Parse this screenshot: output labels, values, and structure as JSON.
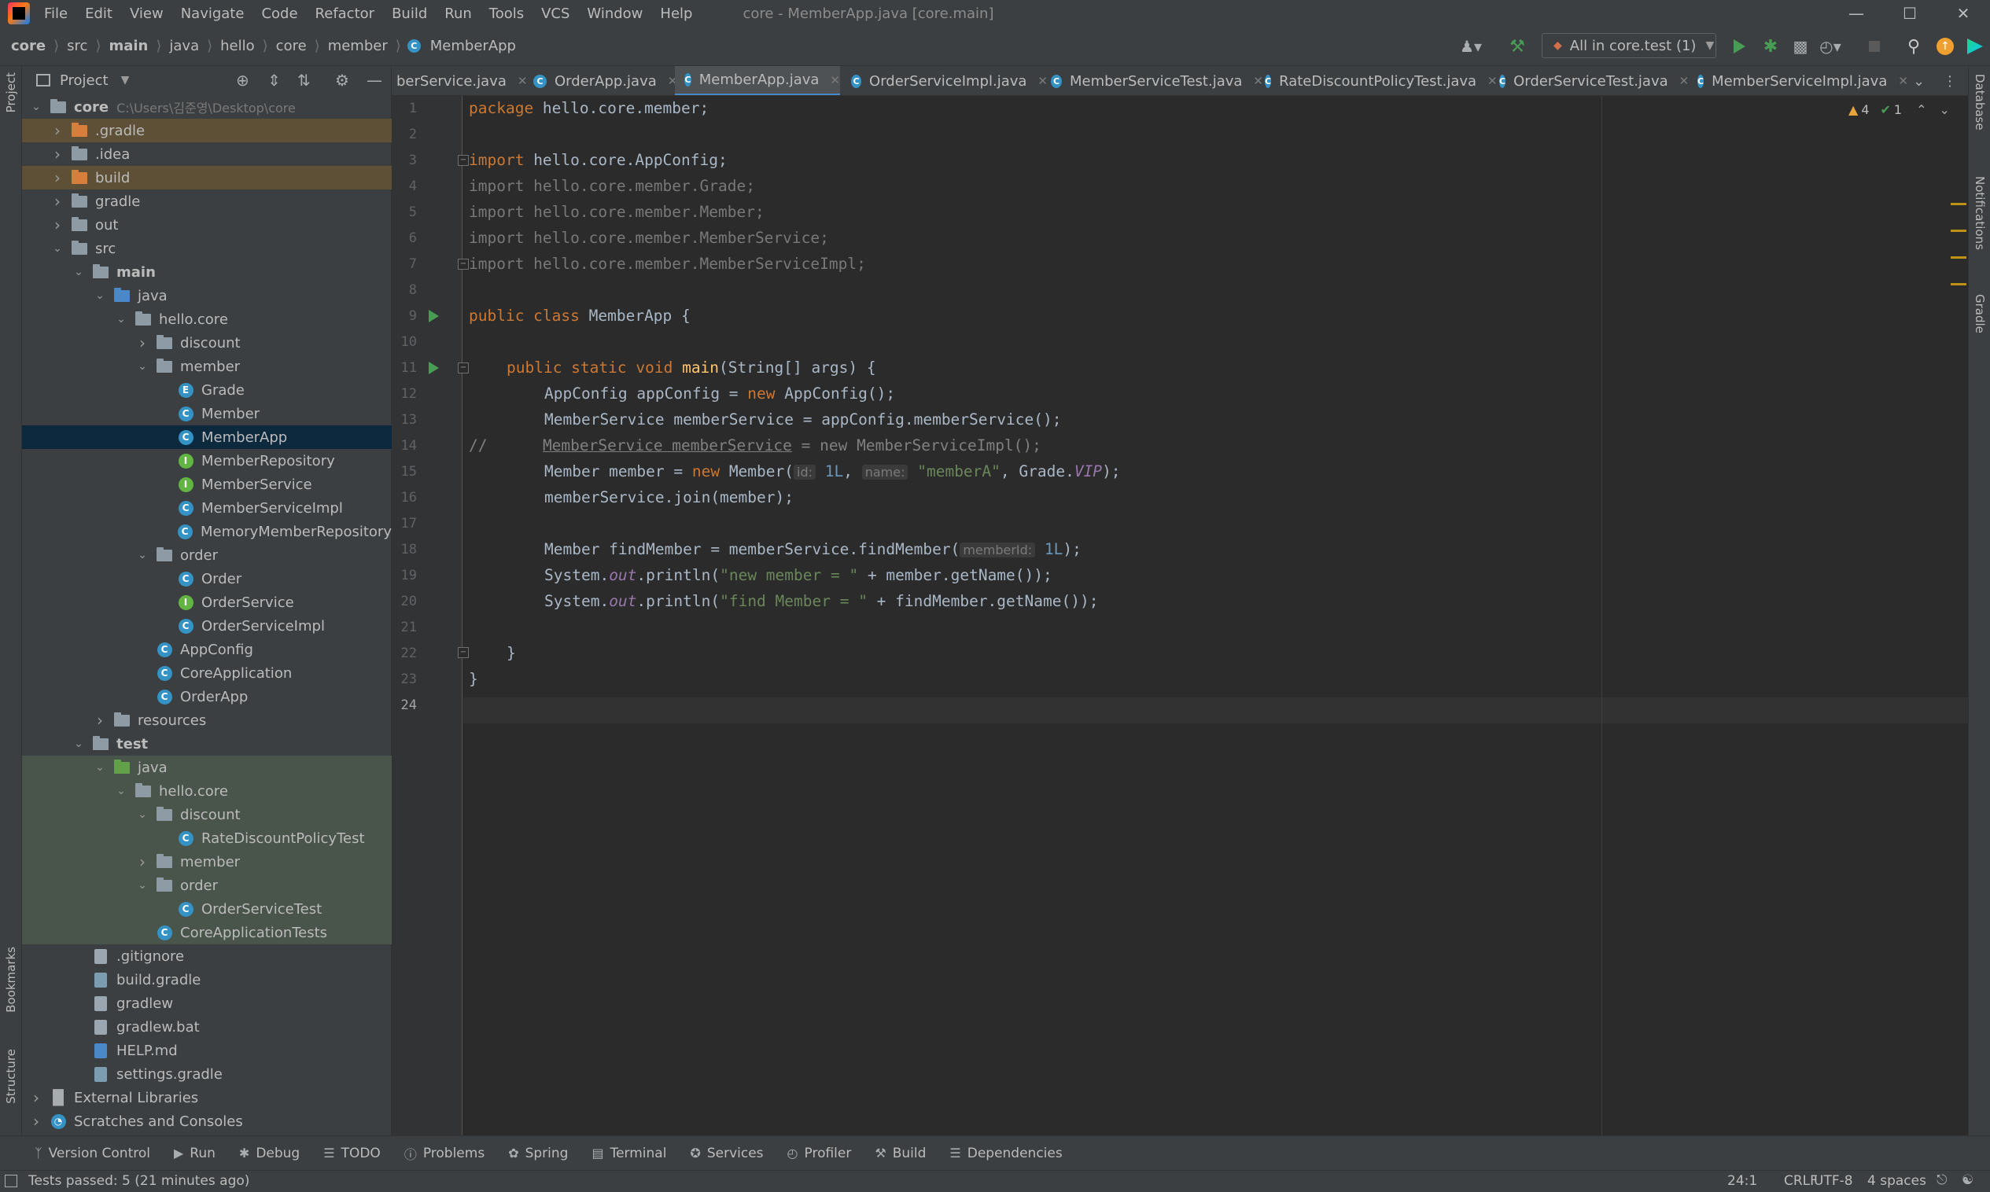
{
  "menu": [
    "File",
    "Edit",
    "View",
    "Navigate",
    "Code",
    "Refactor",
    "Build",
    "Run",
    "Tools",
    "VCS",
    "Window",
    "Help"
  ],
  "window_title": "core - MemberApp.java [core.main]",
  "breadcrumb": [
    "core",
    "src",
    "main",
    "java",
    "hello",
    "core",
    "member",
    "MemberApp"
  ],
  "run_config": "All in core.test (1)",
  "project_panel": {
    "title": "Project",
    "root_path": "C:\\Users\\김준영\\Desktop\\core",
    "tree": [
      {
        "label": "core",
        "depth": 0,
        "icon": "module",
        "expanded": true,
        "bold": true
      },
      {
        "label": ".gradle",
        "depth": 1,
        "icon": "folder-orange",
        "expanded": false
      },
      {
        "label": ".idea",
        "depth": 1,
        "icon": "folder",
        "expanded": false
      },
      {
        "label": "build",
        "depth": 1,
        "icon": "folder-orange",
        "expanded": false
      },
      {
        "label": "gradle",
        "depth": 1,
        "icon": "folder",
        "expanded": false
      },
      {
        "label": "out",
        "depth": 1,
        "icon": "folder",
        "expanded": false
      },
      {
        "label": "src",
        "depth": 1,
        "icon": "folder",
        "expanded": true
      },
      {
        "label": "main",
        "depth": 2,
        "icon": "folder",
        "expanded": true,
        "bold": true
      },
      {
        "label": "java",
        "depth": 3,
        "icon": "folder-blue",
        "expanded": true
      },
      {
        "label": "hello.core",
        "depth": 4,
        "icon": "package",
        "expanded": true
      },
      {
        "label": "discount",
        "depth": 5,
        "icon": "package",
        "expanded": false
      },
      {
        "label": "member",
        "depth": 5,
        "icon": "package",
        "expanded": true
      },
      {
        "label": "Grade",
        "depth": 6,
        "icon": "enum"
      },
      {
        "label": "Member",
        "depth": 6,
        "icon": "class"
      },
      {
        "label": "MemberApp",
        "depth": 6,
        "icon": "class",
        "selected": true
      },
      {
        "label": "MemberRepository",
        "depth": 6,
        "icon": "interface"
      },
      {
        "label": "MemberService",
        "depth": 6,
        "icon": "interface"
      },
      {
        "label": "MemberServiceImpl",
        "depth": 6,
        "icon": "class"
      },
      {
        "label": "MemoryMemberRepository",
        "depth": 6,
        "icon": "class"
      },
      {
        "label": "order",
        "depth": 5,
        "icon": "package",
        "expanded": true
      },
      {
        "label": "Order",
        "depth": 6,
        "icon": "class"
      },
      {
        "label": "OrderService",
        "depth": 6,
        "icon": "interface"
      },
      {
        "label": "OrderServiceImpl",
        "depth": 6,
        "icon": "class"
      },
      {
        "label": "AppConfig",
        "depth": 5,
        "icon": "class"
      },
      {
        "label": "CoreApplication",
        "depth": 5,
        "icon": "class"
      },
      {
        "label": "OrderApp",
        "depth": 5,
        "icon": "class"
      },
      {
        "label": "resources",
        "depth": 3,
        "icon": "folder",
        "expanded": false
      },
      {
        "label": "test",
        "depth": 2,
        "icon": "folder",
        "expanded": true,
        "bold": true
      },
      {
        "label": "java",
        "depth": 3,
        "icon": "folder-green",
        "expanded": true,
        "test": true
      },
      {
        "label": "hello.core",
        "depth": 4,
        "icon": "package",
        "expanded": true,
        "test": true
      },
      {
        "label": "discount",
        "depth": 5,
        "icon": "package",
        "expanded": true,
        "test": true
      },
      {
        "label": "RateDiscountPolicyTest",
        "depth": 6,
        "icon": "class",
        "test": true
      },
      {
        "label": "member",
        "depth": 5,
        "icon": "package",
        "expanded": false,
        "test": true
      },
      {
        "label": "order",
        "depth": 5,
        "icon": "package",
        "expanded": true,
        "test": true
      },
      {
        "label": "OrderServiceTest",
        "depth": 6,
        "icon": "class",
        "test": true
      },
      {
        "label": "CoreApplicationTests",
        "depth": 5,
        "icon": "class",
        "test": true
      },
      {
        "label": ".gitignore",
        "depth": 2,
        "icon": "file"
      },
      {
        "label": "build.gradle",
        "depth": 2,
        "icon": "gradle"
      },
      {
        "label": "gradlew",
        "depth": 2,
        "icon": "file"
      },
      {
        "label": "gradlew.bat",
        "depth": 2,
        "icon": "file"
      },
      {
        "label": "HELP.md",
        "depth": 2,
        "icon": "md"
      },
      {
        "label": "settings.gradle",
        "depth": 2,
        "icon": "gradle"
      },
      {
        "label": "External Libraries",
        "depth": 0,
        "icon": "library",
        "expanded": false
      },
      {
        "label": "Scratches and Consoles",
        "depth": 0,
        "icon": "scratch",
        "expanded": false
      }
    ]
  },
  "tabs": [
    {
      "label": "berService.java",
      "active": false
    },
    {
      "label": "OrderApp.java",
      "active": false
    },
    {
      "label": "MemberApp.java",
      "active": true
    },
    {
      "label": "OrderServiceImpl.java",
      "active": false
    },
    {
      "label": "MemberServiceTest.java",
      "active": false
    },
    {
      "label": "RateDiscountPolicyTest.java",
      "active": false
    },
    {
      "label": "OrderServiceTest.java",
      "active": false
    },
    {
      "label": "MemberServiceImpl.java",
      "active": false
    }
  ],
  "inspections": {
    "warnings": "4",
    "weak_warnings": "1"
  },
  "code": {
    "line_count": 24,
    "current_line": 24,
    "line1": {
      "kw": "package",
      "rest": " hello.core.member;"
    },
    "line3": {
      "kw": "import",
      "rest": " hello.core.AppConfig;"
    },
    "line4": "import hello.core.member.Grade;",
    "line5": "import hello.core.member.Member;",
    "line6": "import hello.core.member.MemberService;",
    "line7": "import hello.core.member.MemberServiceImpl;",
    "line9": {
      "kw": "public class",
      "rest": " MemberApp {"
    },
    "line11": {
      "kw": "public static void",
      "fn": "main",
      "rest": "(String[] args) {"
    },
    "line12": {
      "a": "AppConfig appConfig = ",
      "kw": "new",
      "b": " AppConfig();"
    },
    "line13": "MemberService memberService = appConfig.memberService();",
    "line14": {
      "slash": "//",
      "a": "MemberService memberService",
      "b": " = new MemberServiceImpl();"
    },
    "line15": {
      "a": "Member member = ",
      "kw": "new",
      "b": " Member(",
      "hint1": "id:",
      "num": "1L",
      "c": ", ",
      "hint2": "name:",
      "str": "\"memberA\"",
      "d": ", Grade.",
      "fld": "VIP",
      "e": ");"
    },
    "line16": "memberService.join(member);",
    "line18": {
      "a": "Member findMember = memberService.findMember(",
      "hint": "memberId:",
      "num": "1L",
      "b": ");"
    },
    "line19": {
      "a": "System.",
      "fld": "out",
      "b": ".println(",
      "str": "\"new member = \"",
      "c": " + member.getName());"
    },
    "line20": {
      "a": "System.",
      "fld": "out",
      "b": ".println(",
      "str": "\"find Member = \"",
      "c": " + findMember.getName());"
    },
    "line22": "}",
    "line23": "}"
  },
  "bottom_tools": [
    {
      "label": "Version Control",
      "icon": "branch-icon"
    },
    {
      "label": "Run",
      "icon": "play-icon"
    },
    {
      "label": "Debug",
      "icon": "bug-icon"
    },
    {
      "label": "TODO",
      "icon": "list-icon"
    },
    {
      "label": "Problems",
      "icon": "info-icon"
    },
    {
      "label": "Spring",
      "icon": "leaf-icon"
    },
    {
      "label": "Terminal",
      "icon": "terminal-icon"
    },
    {
      "label": "Services",
      "icon": "services-icon"
    },
    {
      "label": "Profiler",
      "icon": "profiler-icon"
    },
    {
      "label": "Build",
      "icon": "hammer-icon"
    },
    {
      "label": "Dependencies",
      "icon": "layers-icon"
    }
  ],
  "status": {
    "message": "Tests passed: 5 (21 minutes ago)",
    "position": "24:1",
    "line_sep": "CRLF",
    "encoding": "UTF-8",
    "indent": "4 spaces"
  },
  "side_tools": {
    "left_top": "Project",
    "left_bookmarks": "Bookmarks",
    "left_structure": "Structure",
    "right_database": "Database",
    "right_notifications": "Notifications",
    "right_gradle": "Gradle"
  },
  "colors": {
    "accent": "#4a88c7",
    "run_green": "#499c54",
    "keyword": "#cc7832",
    "string": "#6a8759",
    "warning": "#be9117"
  }
}
